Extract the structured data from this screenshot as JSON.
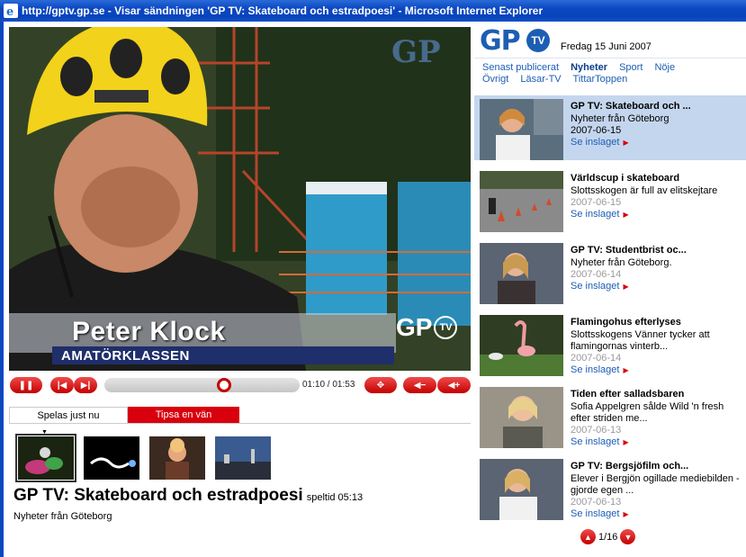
{
  "window": {
    "title": "http://gptv.gp.se - Visar sändningen 'GP TV: Skateboard och estradpoesi' - Microsoft Internet Explorer"
  },
  "video": {
    "overlay_name": "Peter Klock",
    "overlay_subtitle": "AMATÖRKLASSEN",
    "watermark": "GP",
    "corner_logo_gp": "GP",
    "corner_logo_tv": "TV"
  },
  "player": {
    "time": "01:10 / 01:53",
    "progress": 0.62
  },
  "tabs": {
    "playing_now": "Spelas just nu",
    "tip_friend": "Tipsa en vän"
  },
  "current": {
    "title": "GP TV: Skateboard och estradpoesi",
    "duration": "speltid 05:13",
    "source": "Nyheter från Göteborg"
  },
  "sidebar": {
    "logo_gp": "GP",
    "logo_tv": "TV",
    "date": "Fredag 15 Juni 2007",
    "nav_row1": [
      "Senast publicerat",
      "Nyheter",
      "Sport",
      "Nöje"
    ],
    "nav_row2": [
      "Övrigt",
      "Läsar-TV",
      "TittarToppen"
    ],
    "items": [
      {
        "title": "GP TV: Skateboard och ...",
        "desc": "Nyheter från Göteborg",
        "date": "2007-06-15",
        "link": "Se inslaget"
      },
      {
        "title": "Världscup i skateboard",
        "desc": "Slottsskogen är full av elitskejtare",
        "date": "2007-06-15",
        "link": "Se inslaget"
      },
      {
        "title": "GP TV: Studentbrist oc...",
        "desc": "Nyheter från Göteborg.",
        "date": "2007-06-14",
        "link": "Se inslaget"
      },
      {
        "title": "Flamingohus efterlyses",
        "desc": "Slottsskogens Vänner tycker att flamingornas vinterb...",
        "date": "2007-06-14",
        "link": "Se inslaget"
      },
      {
        "title": "Tiden efter salladsbaren",
        "desc": "Sofia Appelgren sålde Wild 'n fresh efter striden me...",
        "date": "2007-06-13",
        "link": "Se inslaget"
      },
      {
        "title": "GP TV: Bergsjöfilm och...",
        "desc": "Elever i Bergjön ogillade mediebilden - gjorde egen ...",
        "date": "2007-06-13",
        "link": "Se inslaget"
      }
    ],
    "pager": "1/16"
  },
  "colors": {
    "accent_red": "#d9000d",
    "brand_blue": "#1d5eb3",
    "highlight_row": "#c4d6ee"
  }
}
